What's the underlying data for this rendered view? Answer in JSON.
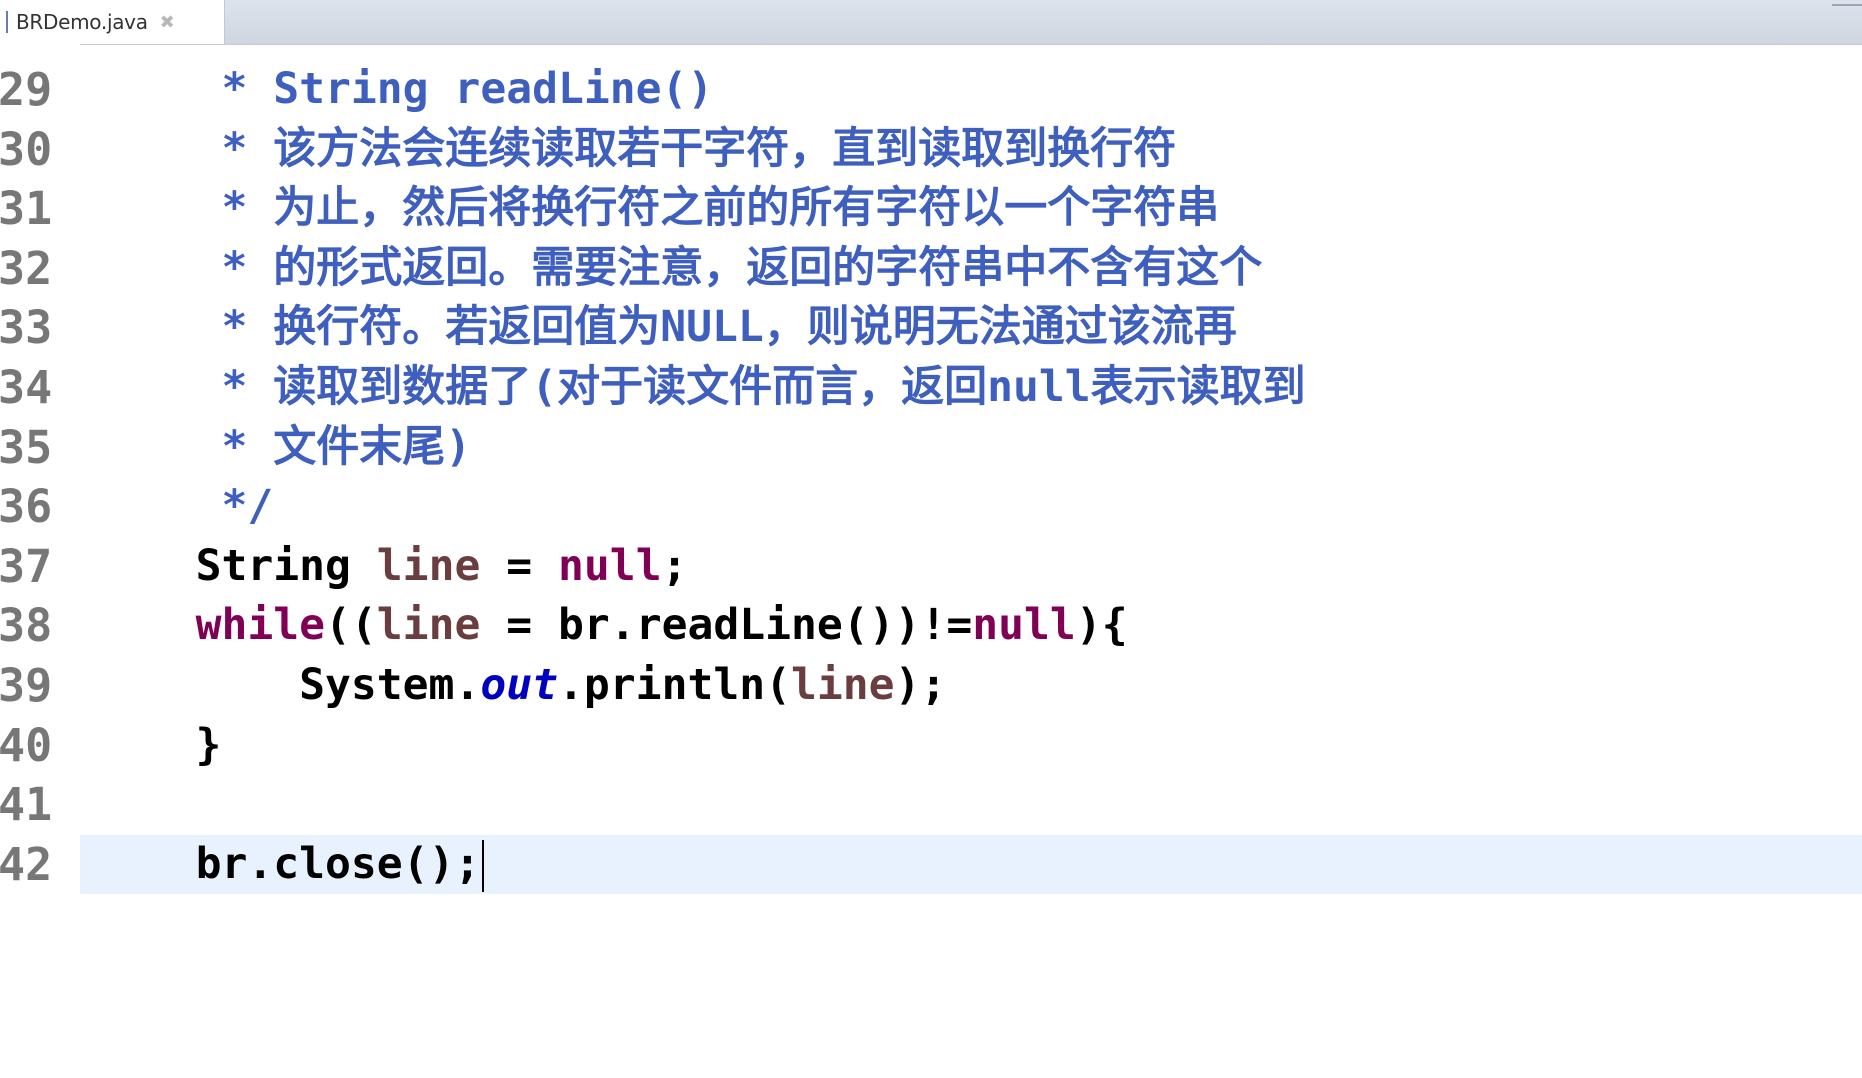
{
  "tab": {
    "filename": "BRDemo.java",
    "close_glyph": "✖"
  },
  "editor": {
    "lines": [
      {
        "no": "29",
        "text": "     * String readLine()"
      },
      {
        "no": "30",
        "text": "     * 该方法会连续读取若干字符，直到读取到换行符"
      },
      {
        "no": "31",
        "text": "     * 为止，然后将换行符之前的所有字符以一个字符串"
      },
      {
        "no": "32",
        "text": "     * 的形式返回。需要注意，返回的字符串中不含有这个"
      },
      {
        "no": "33",
        "text": "     * 换行符。若返回值为NULL，则说明无法通过该流再"
      },
      {
        "no": "34",
        "text": "     * 读取到数据了(对于读文件而言，返回null表示读取到"
      },
      {
        "no": "35",
        "text": "     * 文件末尾)"
      },
      {
        "no": "36",
        "text": "     */"
      },
      {
        "no": "37",
        "text": "    String line = null;"
      },
      {
        "no": "38",
        "text": "    while((line = br.readLine())!=null){"
      },
      {
        "no": "39",
        "text": "        System.out.println(line);"
      },
      {
        "no": "40",
        "text": "    }"
      },
      {
        "no": "41",
        "text": ""
      },
      {
        "no": "42",
        "text": "    br.close();"
      }
    ]
  },
  "colors": {
    "javadoc": "#3f5fbf",
    "keyword": "#7f0055",
    "field": "#0000c0",
    "current_line": "#e8f2fe"
  }
}
